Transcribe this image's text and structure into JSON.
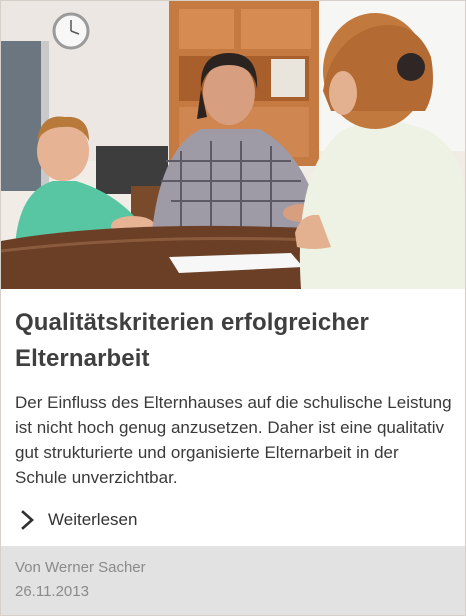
{
  "article": {
    "image_alt": "Eltern und Kind im Gespräch mit einer Lehrerin",
    "title": "Qualitätskriterien erfolgreicher Elternarbeit",
    "teaser": "Der Einfluss des Elternhauses auf die schulische Leistung ist nicht hoch genug anzusetzen. Daher ist eine qualitativ gut strukturierte und organisierte Elternarbeit in der Schule unverzichtbar.",
    "read_more_label": "Weiterlesen",
    "read_more_icon": "chevron-right-icon",
    "author": "Von Werner Sacher",
    "date": "26.11.2013"
  },
  "colors": {
    "title": "#3f3f3f",
    "text": "#3a3a3a",
    "footer_bg": "#e2e2e2",
    "footer_text": "#8a8a8a"
  }
}
